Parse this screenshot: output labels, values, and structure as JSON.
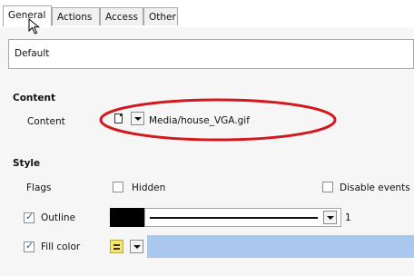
{
  "tabs": [
    "General",
    "Actions",
    "Access",
    "Other"
  ],
  "name_value": "Default",
  "sections": {
    "content": {
      "title": "Content",
      "label": "Content",
      "value": "Media/house_VGA.gif"
    },
    "style": {
      "title": "Style",
      "flags_label": "Flags",
      "hidden_label": "Hidden",
      "disable_events_label": "Disable events",
      "outline_label": "Outline",
      "outline_width": "1",
      "fill_label": "Fill color"
    }
  },
  "colors": {
    "outline": "#000000",
    "fill": "#a9c8ef",
    "annotation_ellipse": "#d2171d"
  },
  "icons": [
    "file-icon",
    "dropdown-arrow-icon",
    "pointer-cursor-icon",
    "fill-style-icon"
  ]
}
